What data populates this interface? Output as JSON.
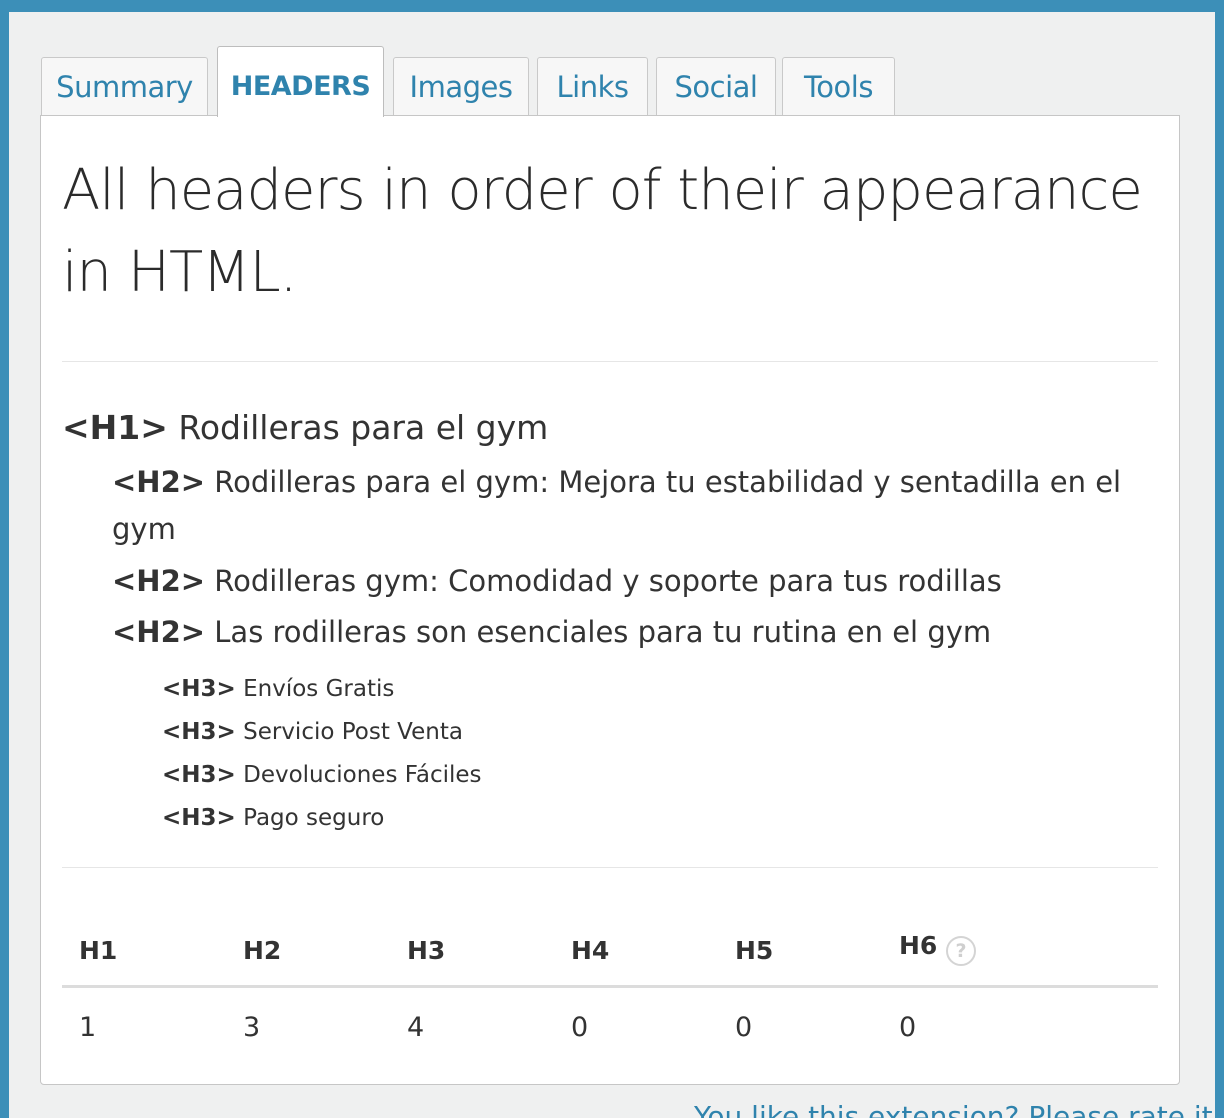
{
  "tabs": [
    {
      "label": "Summary"
    },
    {
      "label": "HEADERS"
    },
    {
      "label": "Images"
    },
    {
      "label": "Links"
    },
    {
      "label": "Social"
    },
    {
      "label": "Tools"
    }
  ],
  "active_tab": "HEADERS",
  "title": "All headers in order of their appearance in HTML.",
  "headers": {
    "h1": [
      {
        "tag": "<H1>",
        "text": "Rodilleras para el gym"
      }
    ],
    "h2": [
      {
        "tag": "<H2>",
        "text": "Rodilleras para el gym: Mejora tu estabilidad y sentadilla en el gym"
      },
      {
        "tag": "<H2>",
        "text": "Rodilleras gym: Comodidad y soporte para tus rodillas"
      },
      {
        "tag": "<H2>",
        "text": "Las rodilleras son esenciales para tu rutina en el gym"
      }
    ],
    "h3": [
      {
        "tag": "<H3>",
        "text": "Envíos Gratis"
      },
      {
        "tag": "<H3>",
        "text": "Servicio Post Venta"
      },
      {
        "tag": "<H3>",
        "text": "Devoluciones Fáciles"
      },
      {
        "tag": "<H3>",
        "text": "Pago seguro"
      }
    ]
  },
  "counts": {
    "headers": [
      "H1",
      "H2",
      "H3",
      "H4",
      "H5",
      "H6"
    ],
    "values": [
      "1",
      "3",
      "4",
      "0",
      "0",
      "0"
    ],
    "help_icon": "?"
  },
  "footer_link": "You like this extension? Please rate it!",
  "colors": {
    "accent": "#2f83ad",
    "outer_border": "#3c8fb8",
    "text": "#333333"
  }
}
